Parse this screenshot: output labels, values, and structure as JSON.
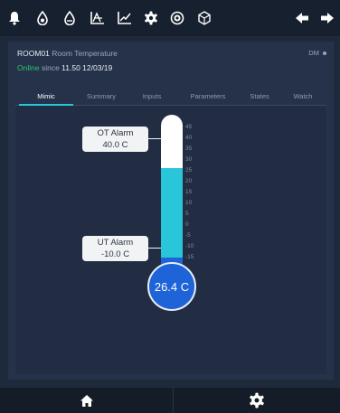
{
  "toolbar": {
    "icons": [
      "bell-icon",
      "drop-icon",
      "drop-outline-icon",
      "trend-chart-icon",
      "line-chart-icon",
      "gear-icon",
      "badge-icon",
      "cube-icon",
      "arrow-left-icon",
      "arrow-right-icon"
    ]
  },
  "device": {
    "id": "ROOM01",
    "description": "Room Temperature",
    "dm_label": "DM",
    "status": "Online",
    "since_label": "since",
    "timestamp": "11.50 12/03/19"
  },
  "tabs": [
    {
      "label": "Mimic",
      "active": true
    },
    {
      "label": "Summary",
      "active": false
    },
    {
      "label": "Inputs",
      "active": false
    },
    {
      "label": "Parameters",
      "active": false
    },
    {
      "label": "States",
      "active": false
    },
    {
      "label": "Watch",
      "active": false
    }
  ],
  "thermometer": {
    "current_value": 26.4,
    "current_label": "26.4 C",
    "scale_min": -15,
    "scale_max": 45,
    "ticks": [
      "45",
      "40",
      "35",
      "30",
      "25",
      "20",
      "15",
      "10",
      "5",
      "0",
      "-5",
      "-10",
      "-15"
    ],
    "ot_alarm": {
      "title": "OT Alarm",
      "value": "40.0 C"
    },
    "ut_alarm": {
      "title": "UT Alarm",
      "value": "-10.0 C"
    },
    "fill_color": "#29c5d8",
    "bulb_color": "#1e63d8"
  },
  "footer": {
    "home_icon": "home-icon",
    "settings_icon": "gear-icon"
  },
  "colors": {
    "accent": "#29c5d8",
    "online": "#28c76f",
    "background": "#1e2a3c",
    "panel": "#26324a"
  }
}
